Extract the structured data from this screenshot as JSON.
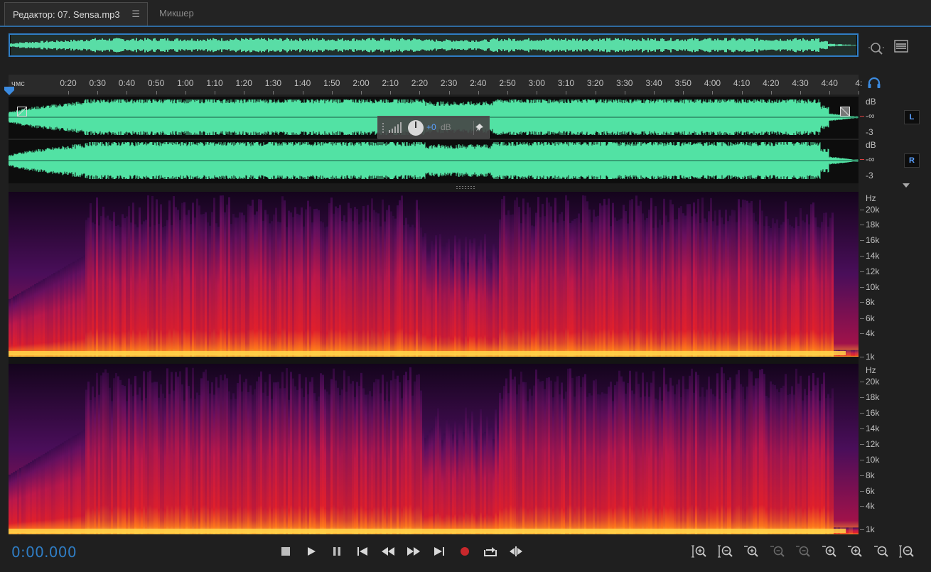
{
  "tabs": {
    "editor_label": "Редактор: 07. Sensa.mp3",
    "mixer_label": "Микшер"
  },
  "colors": {
    "accent": "#2f7dc4",
    "waveform": "#52e2a4",
    "spectral_hot": "#ffd34a",
    "spectral_mid": "#e2202a",
    "spectral_low": "#3a0a4a",
    "channel_label": "#5aa0ff"
  },
  "ruler": {
    "unit": "чмс",
    "ticks": [
      "0:20",
      "0:30",
      "0:40",
      "0:50",
      "1:00",
      "1:10",
      "1:20",
      "1:30",
      "1:40",
      "1:50",
      "2:00",
      "2:10",
      "2:20",
      "2:30",
      "2:40",
      "2:50",
      "3:00",
      "3:10",
      "3:20",
      "3:30",
      "3:40",
      "3:50",
      "4:00",
      "4:10",
      "4:20",
      "4:30",
      "4:40",
      "4:"
    ]
  },
  "amplitude_scale": {
    "left": {
      "db": "dB",
      "neg_inf": "-∞",
      "minus3": "-3"
    },
    "right": {
      "db": "dB",
      "neg_inf": "-∞",
      "minus3": "-3"
    }
  },
  "channels": {
    "left": "L",
    "right": "R"
  },
  "hud": {
    "value": "+0",
    "unit": "dB"
  },
  "frequency_scale": {
    "unit": "Hz",
    "labels": [
      "20k",
      "18k",
      "16k",
      "14k",
      "12k",
      "10k",
      "8k",
      "6k",
      "4k",
      "1k"
    ]
  },
  "timecode": "0:00.000",
  "icons": {
    "transport": [
      "stop-icon",
      "play-icon",
      "pause-icon",
      "skip-to-start-icon",
      "rewind-icon",
      "fast-forward-icon",
      "skip-to-end-icon",
      "record-icon",
      "loop-icon",
      "skip-selection-icon"
    ],
    "zoom": [
      "zoom-in-amplitude-icon",
      "zoom-out-amplitude-icon",
      "zoom-in-time-icon",
      "zoom-out-time-icon",
      "zoom-out-full-icon",
      "zoom-in-at-start-icon",
      "zoom-in-at-end-icon",
      "zoom-to-selection-icon",
      "zoom-selected-tracks-icon"
    ]
  }
}
